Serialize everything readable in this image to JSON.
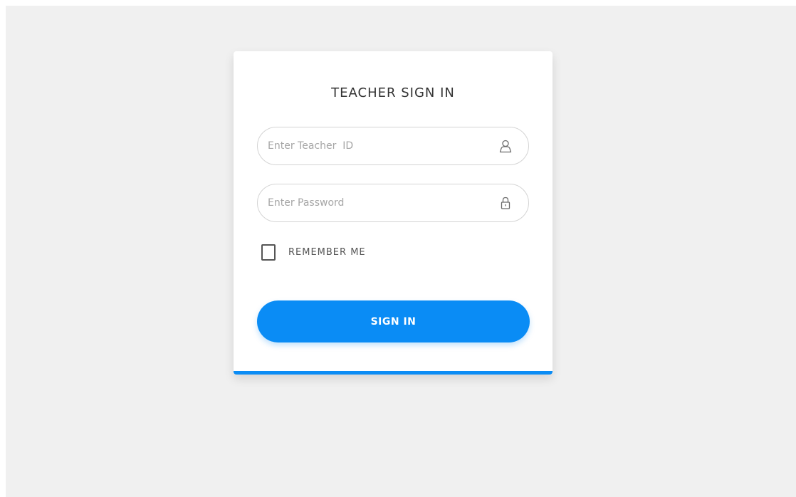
{
  "login": {
    "title": "TEACHER SIGN IN",
    "teacher_id_placeholder": "Enter Teacher  ID",
    "password_placeholder": "Enter Password",
    "remember_label": "REMEMBER ME",
    "remember_checked": false,
    "signin_label": "SIGN IN"
  },
  "icons": {
    "teacher_id_icon": "user-icon",
    "password_icon": "lock-icon"
  },
  "colors": {
    "background": "#f0f0f0",
    "card": "#ffffff",
    "accent": "#0a8cf5",
    "title_text": "#333333",
    "placeholder_text": "#a6a6a6"
  }
}
